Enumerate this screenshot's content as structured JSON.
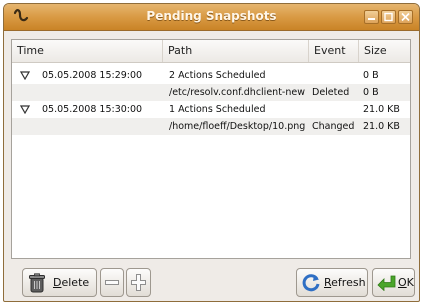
{
  "window": {
    "title": "Pending Snapshots"
  },
  "columns": {
    "time": "Time",
    "path": "Path",
    "event": "Event",
    "size": "Size"
  },
  "rows": [
    {
      "time": "05.05.2008 15:29:00",
      "path": "2 Actions Scheduled",
      "event": "",
      "size": "0 B",
      "expanded": true
    },
    {
      "time": "",
      "path": "/etc/resolv.conf.dhclient-new",
      "event": "Deleted",
      "size": "0 B"
    },
    {
      "time": "05.05.2008 15:30:00",
      "path": "1 Actions Scheduled",
      "event": "",
      "size": "21.0 KB",
      "expanded": true
    },
    {
      "time": "",
      "path": "/home/floeff/Desktop/10.png",
      "event": "Changed",
      "size": "21.0 KB"
    }
  ],
  "buttons": {
    "delete_pre": "",
    "delete_u": "D",
    "delete_post": "elete",
    "refresh_pre": "",
    "refresh_u": "R",
    "refresh_post": "efresh",
    "ok_pre": "",
    "ok_u": "O",
    "ok_post": "K"
  },
  "colors": {
    "titlebar": "#d99a44",
    "alt_row": "#f0efed",
    "refresh_icon": "#2f6fc4",
    "ok_icon": "#4aa52a"
  },
  "icons": {
    "app": "squiggle-icon",
    "minimize": "minimize-icon",
    "maximize": "maximize-icon",
    "close": "close-icon",
    "expander": "triangle-down-icon",
    "delete": "trash-icon",
    "remove": "minus-icon",
    "add": "plus-icon",
    "refresh": "refresh-icon",
    "ok": "green-arrow-icon"
  }
}
